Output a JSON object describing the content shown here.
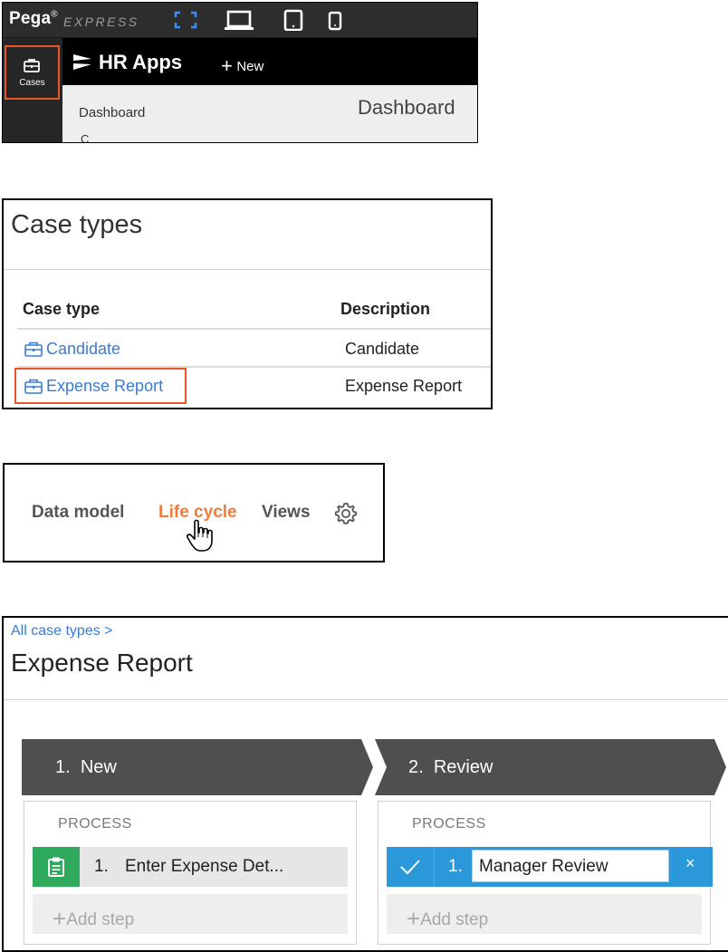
{
  "panel1": {
    "brand": "Pega",
    "brand_mark": "®",
    "product": "EXPRESS",
    "rail": {
      "cases_label": "Cases"
    },
    "app": {
      "name": "HR Apps",
      "new_label": "New"
    },
    "nav": {
      "dashboard_label": "Dashboard",
      "next_item_partial": "C"
    },
    "page_title": "Dashboard",
    "icons": [
      "fullscreen-icon",
      "desktop-icon",
      "tablet-icon",
      "phone-icon",
      "briefcase-icon",
      "pega-logo-icon",
      "plus-icon"
    ],
    "colors": {
      "highlight": "#e8562a",
      "device_selected": "#3a8ef6"
    }
  },
  "panel2": {
    "title": "Case types",
    "columns": [
      "Case type",
      "Description"
    ],
    "rows": [
      {
        "name": "Candidate",
        "description": "Candidate"
      },
      {
        "name": "Expense Report",
        "description": "Expense Report"
      }
    ],
    "highlighted_row": "Expense Report"
  },
  "panel3": {
    "tabs": [
      "Data model",
      "Life cycle",
      "Views"
    ],
    "active_tab": "Life cycle",
    "icons": [
      "gear-icon",
      "hand-cursor-icon"
    ],
    "colors": {
      "active_tab": "#f07c3a",
      "tab": "#555555"
    }
  },
  "panel4": {
    "breadcrumb": "All case types >",
    "title": "Expense Report",
    "stages": [
      {
        "number": "1.",
        "name": "New",
        "process_label": "PROCESS",
        "step": {
          "number": "1.",
          "name": "Enter Expense Det..."
        },
        "add_step_label": "Add step"
      },
      {
        "number": "2.",
        "name": "Review",
        "process_label": "PROCESS",
        "step": {
          "number": "1.",
          "name": "Manager Review"
        },
        "add_step_label": "Add step"
      }
    ],
    "colors": {
      "stage": "#4f4f4f",
      "step_green": "#2eaa5c",
      "step_blue": "#2b98d9"
    }
  }
}
